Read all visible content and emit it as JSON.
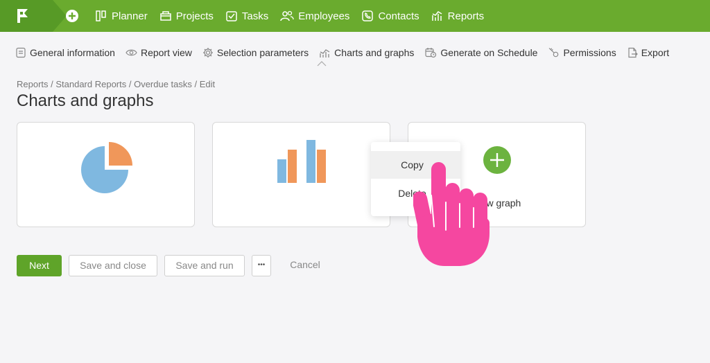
{
  "nav": {
    "items": [
      {
        "label": "Planner",
        "icon": "planner-icon"
      },
      {
        "label": "Projects",
        "icon": "projects-icon"
      },
      {
        "label": "Tasks",
        "icon": "tasks-icon"
      },
      {
        "label": "Employees",
        "icon": "employees-icon"
      },
      {
        "label": "Contacts",
        "icon": "contacts-icon"
      },
      {
        "label": "Reports",
        "icon": "reports-icon"
      }
    ]
  },
  "toolbar": {
    "items": [
      {
        "label": "General information",
        "icon": "document-icon"
      },
      {
        "label": "Report view",
        "icon": "eye-icon"
      },
      {
        "label": "Selection parameters",
        "icon": "gear-icon"
      },
      {
        "label": "Charts and graphs",
        "icon": "chart-icon",
        "active": true
      },
      {
        "label": "Generate on Schedule",
        "icon": "calendar-clock-icon"
      },
      {
        "label": "Permissions",
        "icon": "key-icon"
      },
      {
        "label": "Export",
        "icon": "export-icon"
      }
    ]
  },
  "breadcrumb": "Reports / Standard Reports / Overdue tasks / Edit",
  "page_title": "Charts and graphs",
  "cards": {
    "add_label": "New graph"
  },
  "context_menu": {
    "copy": "Copy",
    "delete": "Delete"
  },
  "actions": {
    "next": "Next",
    "save_close": "Save and close",
    "save_run": "Save and run",
    "more": "•••",
    "cancel": "Cancel"
  },
  "colors": {
    "brand_green": "#6aab2e",
    "chart_blue": "#7fb8e0",
    "chart_orange": "#f0975a",
    "hand_pink": "#f547a0"
  }
}
